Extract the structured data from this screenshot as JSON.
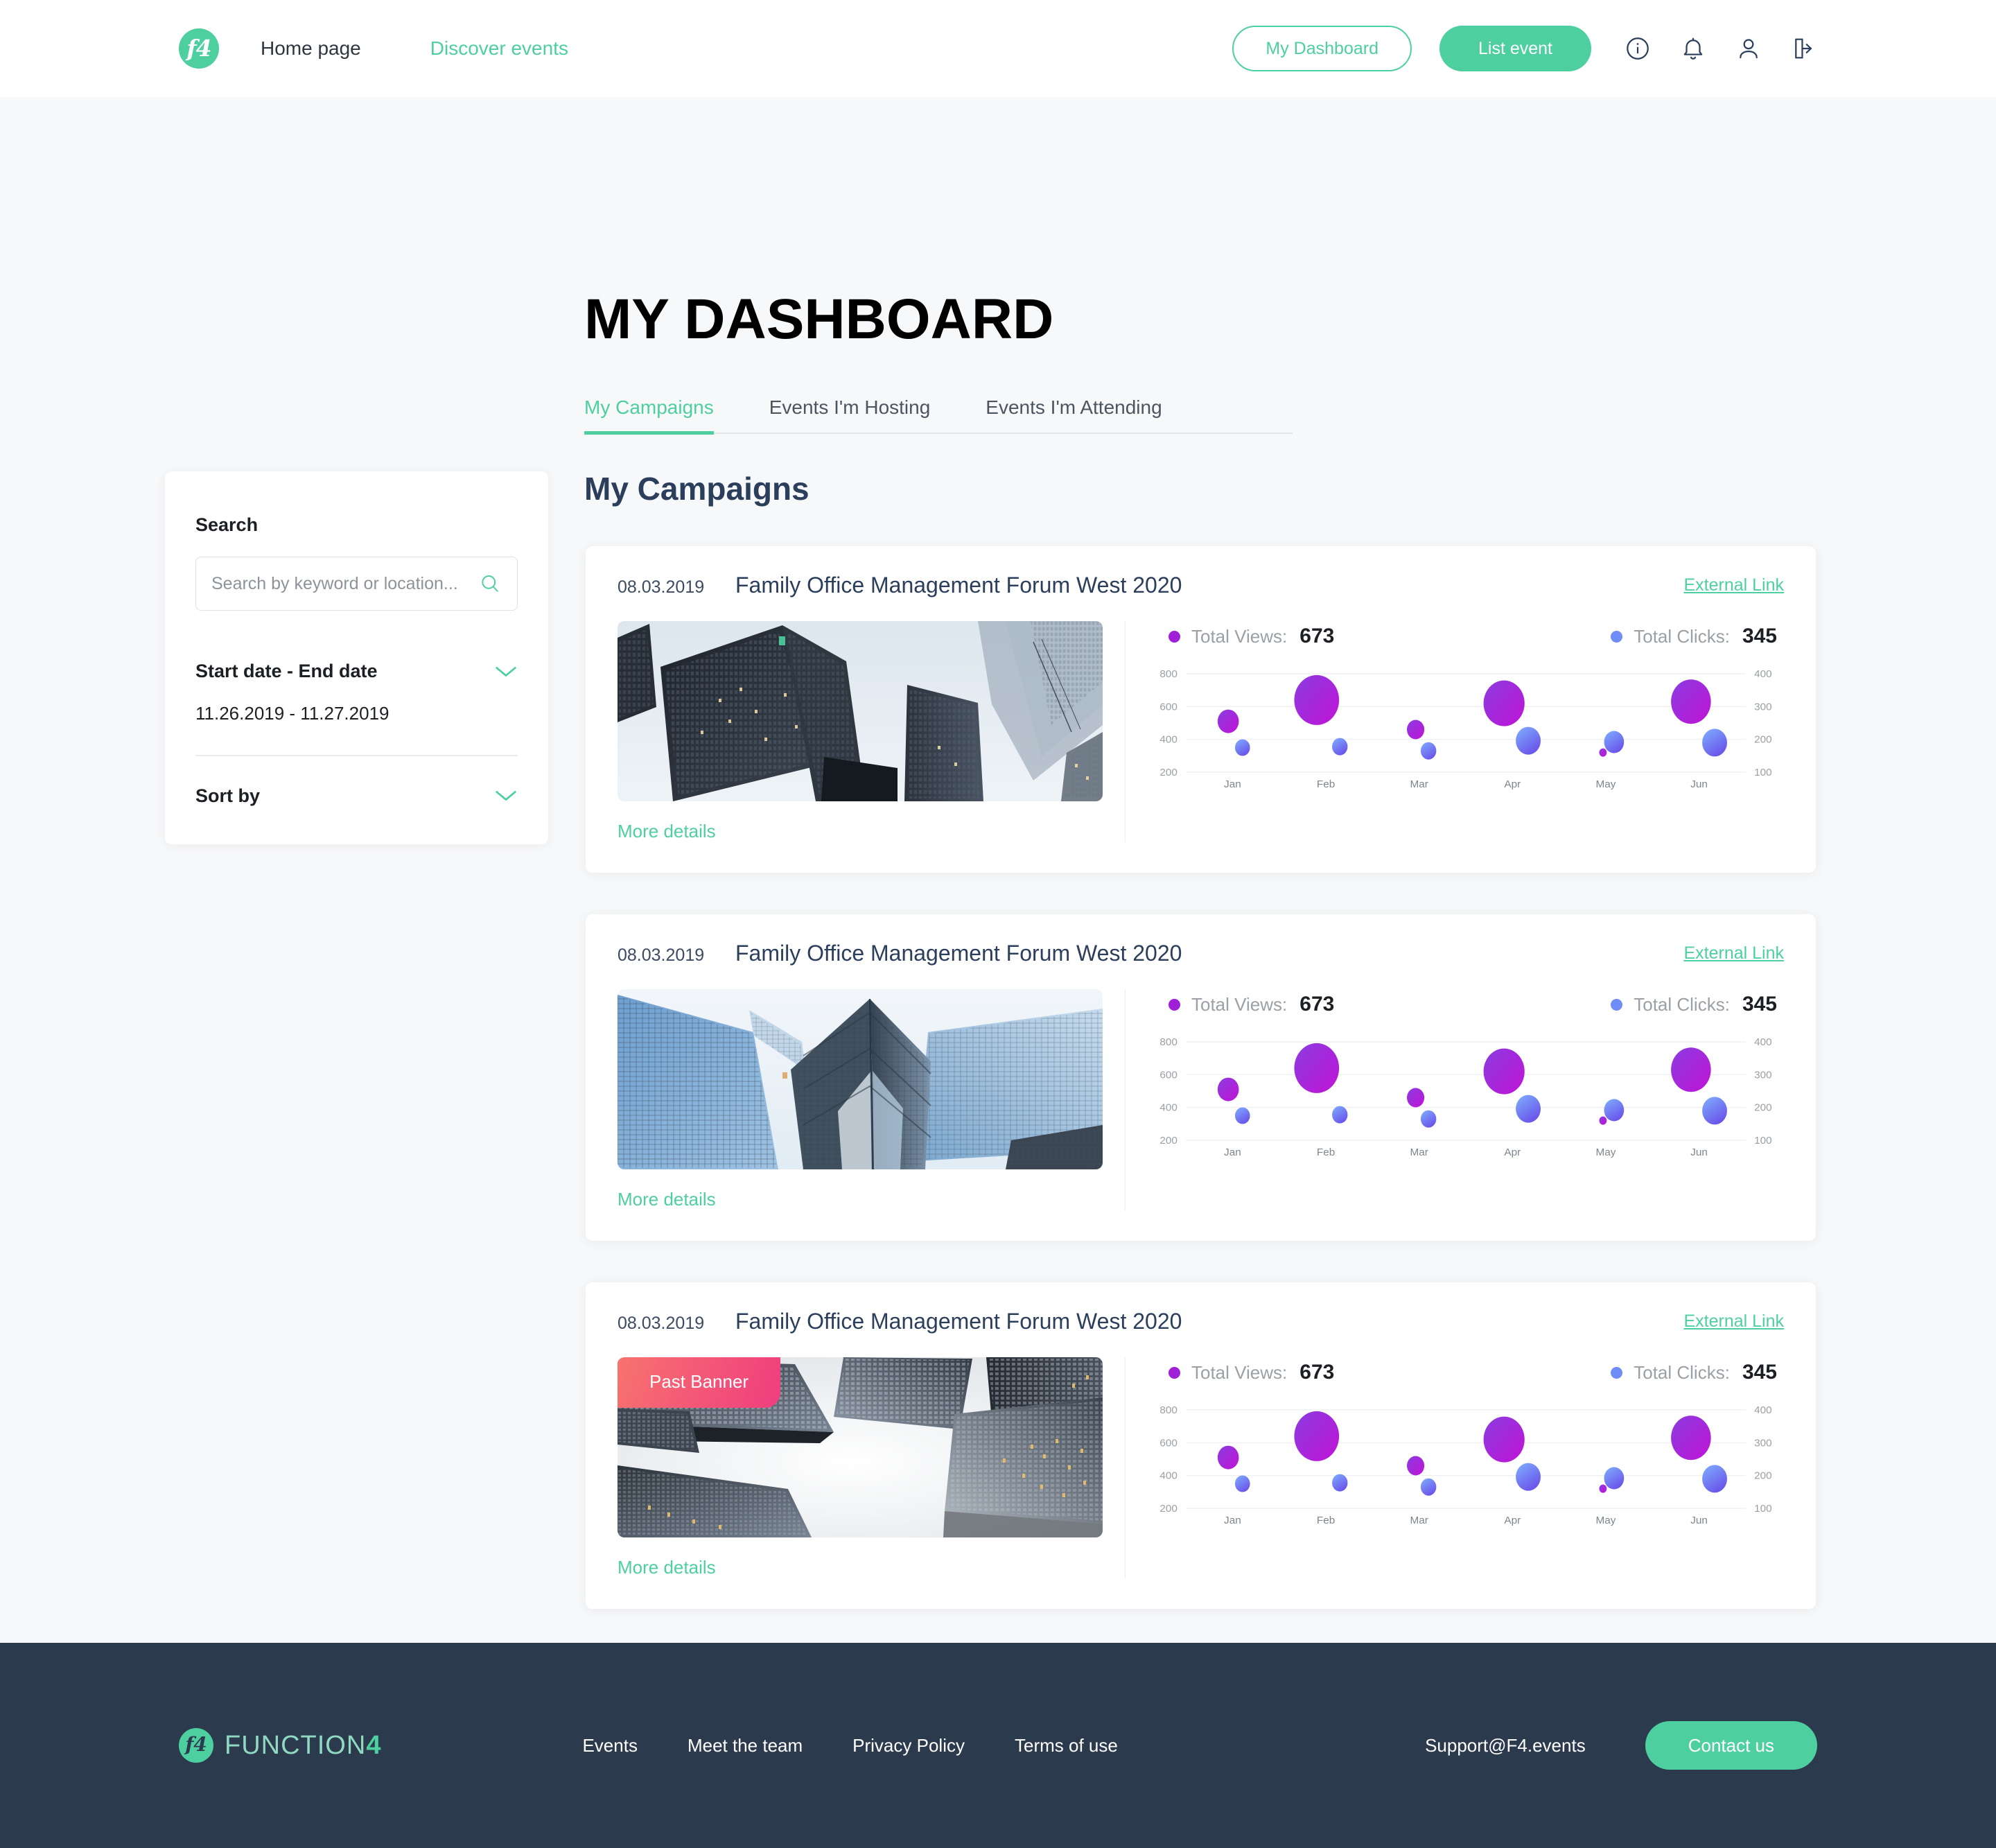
{
  "header": {
    "logo_text": "f4",
    "nav": [
      {
        "label": "Home page",
        "accent": false
      },
      {
        "label": "Discover events",
        "accent": true
      }
    ],
    "dashboard_button": "My Dashboard",
    "list_event_button": "List event",
    "icons": [
      "info-icon",
      "bell-icon",
      "user-icon",
      "logout-icon"
    ]
  },
  "page": {
    "title": "MY DASHBOARD",
    "tabs": [
      {
        "label": "My Campaigns",
        "active": true
      },
      {
        "label": "Events I'm Hosting",
        "active": false
      },
      {
        "label": "Events I'm Attending",
        "active": false
      }
    ],
    "section_heading": "My Campaigns"
  },
  "sidebar": {
    "search_label": "Search",
    "search_placeholder": "Search by keyword or location...",
    "search_value": "",
    "date_filter_label": "Start date - End date",
    "date_range_value": "11.26.2019 - 11.27.2019",
    "sort_label": "Sort by"
  },
  "cards": [
    {
      "date": "08.03.2019",
      "title": "Family Office Management Forum West 2020",
      "external_link": "External Link",
      "more_details": "More details",
      "badge": null,
      "image": "dark-skyscrapers"
    },
    {
      "date": "08.03.2019",
      "title": "Family Office Management Forum West 2020",
      "external_link": "External Link",
      "more_details": "More details",
      "badge": null,
      "image": "blue-glass-tower"
    },
    {
      "date": "08.03.2019",
      "title": "Family Office Management Forum West 2020",
      "external_link": "External Link",
      "more_details": "More details",
      "badge": "Past Banner",
      "image": "grey-skyscrapers-upward"
    }
  ],
  "chart_data": {
    "type": "scatter",
    "title": "",
    "categories": [
      "Jan",
      "Feb",
      "Mar",
      "Apr",
      "May",
      "Jun"
    ],
    "xlabel": "",
    "ylabel": "",
    "left_axis": {
      "label": "Total Views",
      "ticks": [
        200,
        400,
        600,
        800
      ],
      "ylim": [
        200,
        800
      ]
    },
    "right_axis": {
      "label": "Total Clicks",
      "ticks": [
        100,
        200,
        300,
        400
      ],
      "ylim": [
        100,
        400
      ]
    },
    "grid": true,
    "legend_position": "top",
    "series": [
      {
        "name": "Total Views",
        "total_label": "Total Views:",
        "total": "673",
        "color": "#a020d8",
        "axis": "left",
        "values": [
          510,
          640,
          460,
          620,
          320,
          630
        ],
        "sizes": [
          34,
          72,
          28,
          66,
          12,
          64
        ]
      },
      {
        "name": "Total Clicks",
        "total_label": "Total Clicks:",
        "total": "345",
        "color": "#6f8cf7",
        "axis": "right",
        "values": [
          175,
          178,
          165,
          196,
          192,
          190
        ],
        "sizes": [
          24,
          25,
          25,
          40,
          32,
          40
        ]
      }
    ]
  },
  "footer": {
    "logo_text": "f4",
    "wordmark_main": "FUNCTION",
    "wordmark_accent": "4",
    "nav": [
      "Events",
      "Meet the team",
      "Privacy Policy",
      "Terms of use"
    ],
    "support": "Support@F4.events",
    "contact_button": "Contact us"
  },
  "colors": {
    "accent_green": "#4ecfa0",
    "navy": "#2b3e5b",
    "footer_bg": "#2c3a4d",
    "views_purple": "#a020d8",
    "clicks_blue": "#6f8cf7",
    "badge_pink": "#ef3d7f"
  }
}
